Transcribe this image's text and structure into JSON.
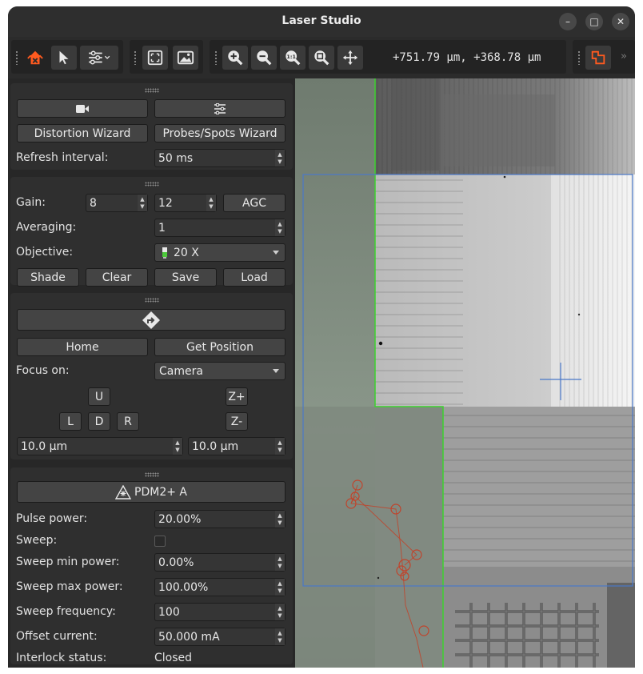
{
  "window": {
    "title": "Laser Studio"
  },
  "toolbar": {
    "coordinates": "+751.79 µm, +368.78 µm"
  },
  "camera": {
    "distortion_wizard": "Distortion Wizard",
    "probes_wizard": "Probes/Spots Wizard",
    "refresh_label": "Refresh interval:",
    "refresh_value": "50 ms"
  },
  "image": {
    "gain_label": "Gain:",
    "gain_value_1": "8",
    "gain_value_2": "12",
    "agc": "AGC",
    "averaging_label": "Averaging:",
    "averaging_value": "1",
    "objective_label": "Objective:",
    "objective_value": "20 X",
    "shade": "Shade",
    "clear": "Clear",
    "save": "Save",
    "load": "Load"
  },
  "stage": {
    "home": "Home",
    "get_position": "Get Position",
    "focus_label": "Focus on:",
    "focus_value": "Camera",
    "u": "U",
    "l": "L",
    "d": "D",
    "r": "R",
    "zplus": "Z+",
    "zminus": "Z-",
    "step_xy": "10.0 µm",
    "step_z": "10.0 µm"
  },
  "laser": {
    "device": "PDM2+ A",
    "pulse_power_label": "Pulse power:",
    "pulse_power_value": "20.00%",
    "sweep_label": "Sweep:",
    "sweep_checked": false,
    "sweep_min_label": "Sweep min power:",
    "sweep_min_value": "0.00%",
    "sweep_max_label": "Sweep max power:",
    "sweep_max_value": "100.00%",
    "sweep_freq_label": "Sweep frequency:",
    "sweep_freq_value": "100",
    "offset_label": "Offset current:",
    "offset_value": "50.000 mA",
    "interlock_label": "Interlock status:",
    "interlock_value": "Closed"
  },
  "colors": {
    "accent": "#ff5a1f",
    "selection_rect": "#4a78c8",
    "green_outline": "#3cd22e",
    "probe_path": "#c0442c"
  }
}
